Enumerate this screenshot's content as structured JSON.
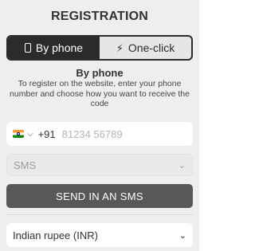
{
  "title": "REGISTRATION",
  "tabs": [
    {
      "label": "By phone",
      "icon": "phone-icon",
      "active": true
    },
    {
      "label": "One-click",
      "icon": "lightning-icon",
      "active": false
    }
  ],
  "subtitle": "By phone",
  "description": "To register on the website, enter your phone number and choose how you want to receive the code",
  "phone": {
    "country_code": "+91",
    "placeholder": "81234 56789",
    "flag": "india-flag-icon"
  },
  "method": {
    "value": "SMS"
  },
  "send_button_label": "SEND IN AN SMS",
  "currency": {
    "value": "Indian rupee (INR)"
  },
  "colors": {
    "panel_bg": "#eeeeee",
    "active_tab_bg": "#2b2b2b",
    "button_bg": "#585858"
  }
}
